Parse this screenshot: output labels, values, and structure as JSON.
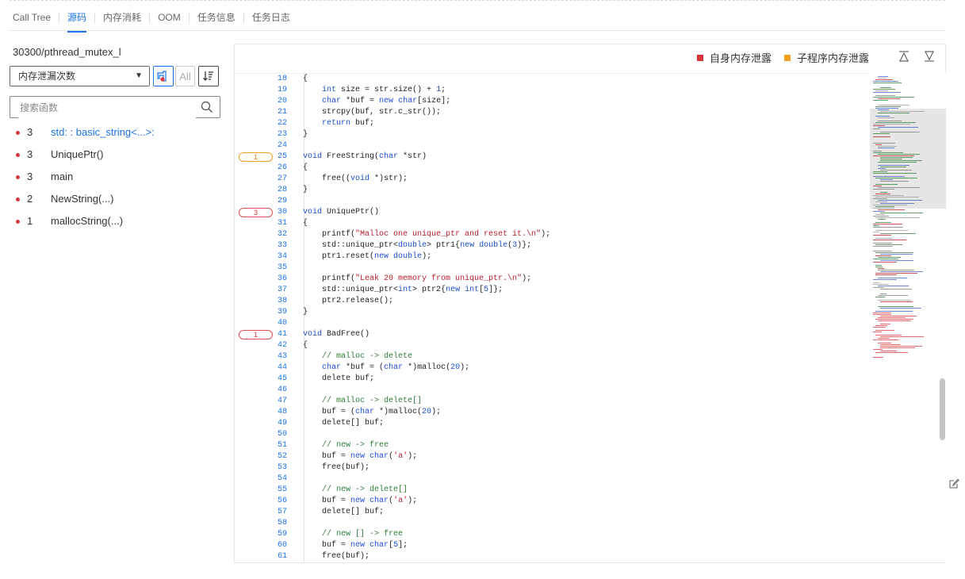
{
  "tabs": [
    "Call Tree",
    "源码",
    "内存消耗",
    "OOM",
    "任务信息",
    "任务日志"
  ],
  "active_tab": "源码",
  "process_name": "30300/pthread_mutex_l",
  "sort_select": {
    "selected": "内存泄漏次数"
  },
  "all_button_label": "All",
  "search": {
    "placeholder": "搜索函数",
    "value": ""
  },
  "functions": [
    {
      "count": "3",
      "name": "std: : basic_string<...>:"
    },
    {
      "count": "3",
      "name": "UniquePtr()"
    },
    {
      "count": "3",
      "name": "main"
    },
    {
      "count": "2",
      "name": "NewString(...)"
    },
    {
      "count": "1",
      "name": "mallocString(...)"
    }
  ],
  "legend": {
    "self_leak": "自身内存泄露",
    "child_leak": "子程序内存泄露",
    "self_color": "#d9363e",
    "child_color": "#f0a020"
  },
  "markers": [
    {
      "line": 25,
      "count": "1",
      "type": "orange"
    },
    {
      "line": 30,
      "count": "3",
      "type": "red"
    },
    {
      "line": 41,
      "count": "1",
      "type": "red"
    }
  ],
  "code_lines": [
    {
      "n": "18",
      "html": "{"
    },
    {
      "n": "19",
      "html": "    <span class=\"kw\">int</span> size = str.size() + <span class=\"nm\">1</span>;"
    },
    {
      "n": "20",
      "html": "    <span class=\"kw\">char</span> *buf = <span class=\"kw\">new</span> <span class=\"kw\">char</span>[size];"
    },
    {
      "n": "21",
      "html": "    strcpy(buf, str.c_str());"
    },
    {
      "n": "22",
      "html": "    <span class=\"kw\">return</span> buf;"
    },
    {
      "n": "23",
      "html": "}"
    },
    {
      "n": "24",
      "html": ""
    },
    {
      "n": "25",
      "html": "<span class=\"kw\">void</span> FreeString(<span class=\"kw\">char</span> *str)"
    },
    {
      "n": "26",
      "html": "{"
    },
    {
      "n": "27",
      "html": "    free((<span class=\"kw\">void</span> *)str);"
    },
    {
      "n": "28",
      "html": "}"
    },
    {
      "n": "29",
      "html": ""
    },
    {
      "n": "30",
      "html": "<span class=\"kw\">void</span> UniquePtr()"
    },
    {
      "n": "31",
      "html": "{"
    },
    {
      "n": "32",
      "html": "    printf(<span class=\"str\">\"Malloc one unique_ptr and reset it.\\n\"</span>);"
    },
    {
      "n": "33",
      "html": "    std::unique_ptr&lt;<span class=\"kw\">double</span>&gt; ptr1{<span class=\"kw\">new</span> <span class=\"kw\">double</span>(<span class=\"nm\">3</span>)};"
    },
    {
      "n": "34",
      "html": "    ptr1.reset(<span class=\"kw\">new</span> <span class=\"kw\">double</span>);"
    },
    {
      "n": "35",
      "html": ""
    },
    {
      "n": "36",
      "html": "    printf(<span class=\"str\">\"Leak 20 memory from unique_ptr.\\n\"</span>);"
    },
    {
      "n": "37",
      "html": "    std::unique_ptr&lt;<span class=\"kw\">int</span>&gt; ptr2{<span class=\"kw\">new</span> <span class=\"kw\">int</span>[<span class=\"nm\">5</span>]};"
    },
    {
      "n": "38",
      "html": "    ptr2.release();"
    },
    {
      "n": "39",
      "html": "}"
    },
    {
      "n": "40",
      "html": ""
    },
    {
      "n": "41",
      "html": "<span class=\"kw\">void</span> BadFree()"
    },
    {
      "n": "42",
      "html": "{"
    },
    {
      "n": "43",
      "html": "    <span class=\"cm\">// malloc -&gt; delete</span>"
    },
    {
      "n": "44",
      "html": "    <span class=\"kw\">char</span> *buf = (<span class=\"kw\">char</span> *)malloc(<span class=\"nm\">20</span>);"
    },
    {
      "n": "45",
      "html": "    delete buf;"
    },
    {
      "n": "46",
      "html": ""
    },
    {
      "n": "47",
      "html": "    <span class=\"cm\">// malloc -&gt; delete[]</span>"
    },
    {
      "n": "48",
      "html": "    buf = (<span class=\"kw\">char</span> *)malloc(<span class=\"nm\">20</span>);"
    },
    {
      "n": "49",
      "html": "    delete[] buf;"
    },
    {
      "n": "50",
      "html": ""
    },
    {
      "n": "51",
      "html": "    <span class=\"cm\">// new -&gt; free</span>"
    },
    {
      "n": "52",
      "html": "    buf = <span class=\"kw\">new</span> <span class=\"kw\">char</span>(<span class=\"ch\">'a'</span>);"
    },
    {
      "n": "53",
      "html": "    free(buf);"
    },
    {
      "n": "54",
      "html": ""
    },
    {
      "n": "55",
      "html": "    <span class=\"cm\">// new -&gt; delete[]</span>"
    },
    {
      "n": "56",
      "html": "    buf = <span class=\"kw\">new</span> <span class=\"kw\">char</span>(<span class=\"ch\">'a'</span>);"
    },
    {
      "n": "57",
      "html": "    delete[] buf;"
    },
    {
      "n": "58",
      "html": ""
    },
    {
      "n": "59",
      "html": "    <span class=\"cm\">// new [] -&gt; free</span>"
    },
    {
      "n": "60",
      "html": "    buf = <span class=\"kw\">new</span> <span class=\"kw\">char</span>[<span class=\"nm\">5</span>];"
    },
    {
      "n": "61",
      "html": "    free(buf);"
    }
  ]
}
